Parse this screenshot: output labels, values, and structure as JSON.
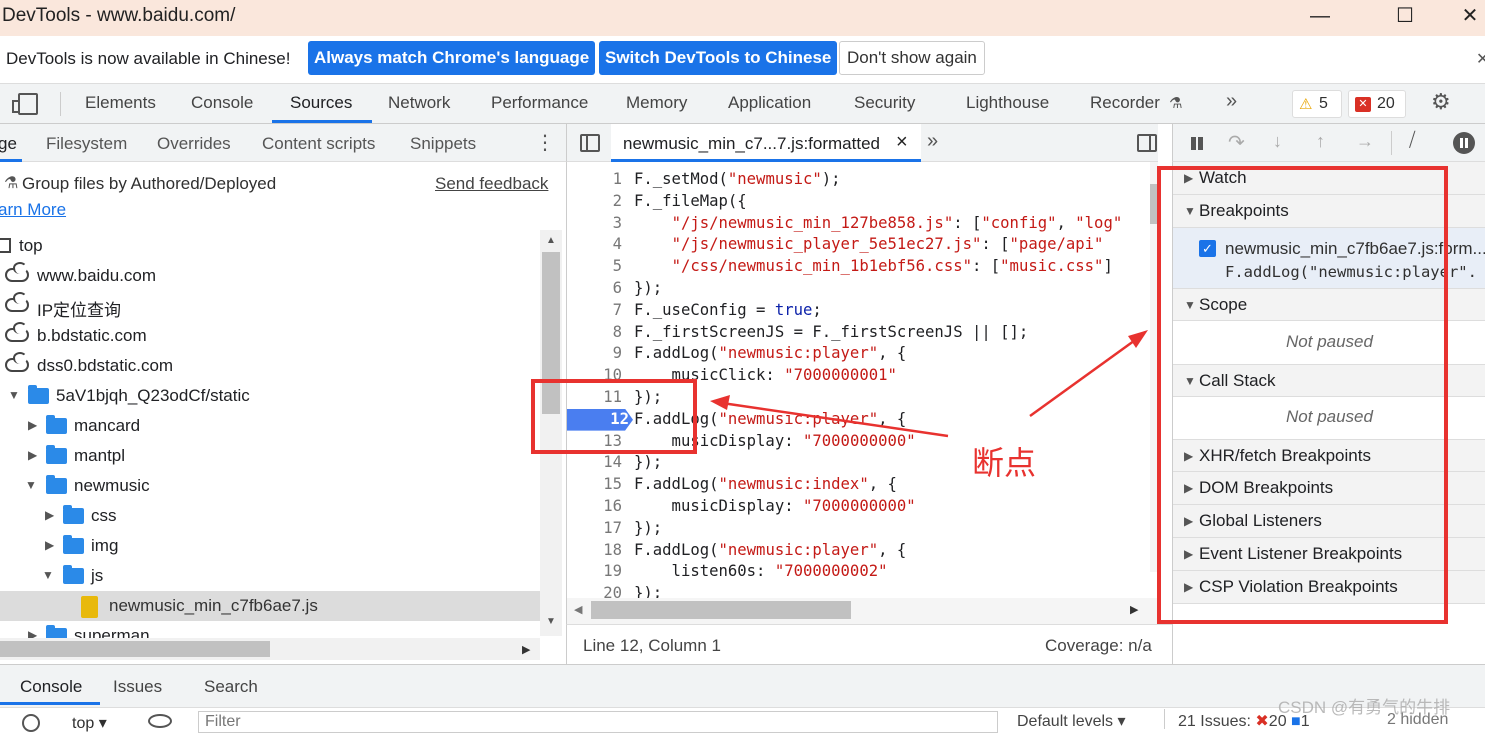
{
  "window": {
    "title": "DevTools - www.baidu.com/",
    "minimize": "—",
    "maximize": "☐",
    "close": "✕"
  },
  "infobar": {
    "message": "DevTools is now available in Chinese!",
    "btn_match": "Always match Chrome's language",
    "btn_switch": "Switch DevTools to Chinese",
    "btn_dont": "Don't show again",
    "close": "✕"
  },
  "maintabs": {
    "items": [
      "Elements",
      "Console",
      "Sources",
      "Network",
      "Performance",
      "Memory",
      "Application",
      "Security",
      "Lighthouse",
      "Recorder"
    ],
    "more": "»",
    "warnings": "5",
    "errors": "20"
  },
  "navigator": {
    "tabs": [
      "ge",
      "Filesystem",
      "Overrides",
      "Content scripts",
      "Snippets"
    ],
    "group_files": "Group files by Authored/Deployed",
    "send_feedback": "Send feedback",
    "learn_more": "arn More",
    "tree": [
      "top",
      "www.baidu.com",
      "IP定位查询",
      "b.bdstatic.com",
      "dss0.bdstatic.com",
      "5aV1bjqh_Q23odCf/static",
      "mancard",
      "mantpl",
      "newmusic",
      "css",
      "img",
      "js",
      "newmusic_min_c7fb6ae7.js",
      "superman"
    ]
  },
  "editor": {
    "tab_name": "newmusic_min_c7...7.js:formatted",
    "tab_close": "×",
    "more": "»",
    "lines": [
      {
        "n": "1",
        "parts": [
          [
            "F._setMod(",
            ""
          ],
          [
            "\"newmusic\"",
            "str"
          ],
          [
            ");",
            ""
          ]
        ]
      },
      {
        "n": "2",
        "parts": [
          [
            "F._fileMap({",
            ""
          ]
        ]
      },
      {
        "n": "3",
        "parts": [
          [
            "    ",
            ""
          ],
          [
            "\"/js/newmusic_min_127be858.js\"",
            "str"
          ],
          [
            ": [",
            ""
          ],
          [
            "\"config\"",
            "str"
          ],
          [
            ", ",
            ""
          ],
          [
            "\"log\"",
            "str"
          ]
        ]
      },
      {
        "n": "4",
        "parts": [
          [
            "    ",
            ""
          ],
          [
            "\"/js/newmusic_player_5e51ec27.js\"",
            "str"
          ],
          [
            ": [",
            ""
          ],
          [
            "\"page/api\"",
            "str"
          ]
        ]
      },
      {
        "n": "5",
        "parts": [
          [
            "    ",
            ""
          ],
          [
            "\"/css/newmusic_min_1b1ebf56.css\"",
            "str"
          ],
          [
            ": [",
            ""
          ],
          [
            "\"music.css\"",
            "str"
          ],
          [
            "]",
            ""
          ]
        ]
      },
      {
        "n": "6",
        "parts": [
          [
            "});",
            ""
          ]
        ]
      },
      {
        "n": "7",
        "parts": [
          [
            "F._useConfig = ",
            ""
          ],
          [
            "true",
            "kw"
          ],
          [
            ";",
            ""
          ]
        ]
      },
      {
        "n": "8",
        "parts": [
          [
            "F._firstScreenJS = F._firstScreenJS || [];",
            ""
          ]
        ]
      },
      {
        "n": "9",
        "parts": [
          [
            "F.addLog(",
            ""
          ],
          [
            "\"newmusic:player\"",
            "str"
          ],
          [
            ", {",
            ""
          ]
        ]
      },
      {
        "n": "10",
        "parts": [
          [
            "    musicClick: ",
            ""
          ],
          [
            "\"7000000001\"",
            "str"
          ]
        ]
      },
      {
        "n": "11",
        "parts": [
          [
            "});",
            ""
          ]
        ]
      },
      {
        "n": "12",
        "parts": [
          [
            "F.addLog(",
            ""
          ],
          [
            "\"newmusic:player\"",
            "str"
          ],
          [
            ", {",
            ""
          ]
        ]
      },
      {
        "n": "13",
        "parts": [
          [
            "    musicDisplay: ",
            ""
          ],
          [
            "\"7000000000\"",
            "str"
          ]
        ]
      },
      {
        "n": "14",
        "parts": [
          [
            "});",
            ""
          ]
        ]
      },
      {
        "n": "15",
        "parts": [
          [
            "F.addLog(",
            ""
          ],
          [
            "\"newmusic:index\"",
            "str"
          ],
          [
            ", {",
            ""
          ]
        ]
      },
      {
        "n": "16",
        "parts": [
          [
            "    musicDisplay: ",
            ""
          ],
          [
            "\"7000000000\"",
            "str"
          ]
        ]
      },
      {
        "n": "17",
        "parts": [
          [
            "});",
            ""
          ]
        ]
      },
      {
        "n": "18",
        "parts": [
          [
            "F.addLog(",
            ""
          ],
          [
            "\"newmusic:player\"",
            "str"
          ],
          [
            ", {",
            ""
          ]
        ]
      },
      {
        "n": "19",
        "parts": [
          [
            "    listen60s: ",
            ""
          ],
          [
            "\"7000000002\"",
            "str"
          ]
        ]
      },
      {
        "n": "20",
        "parts": [
          [
            "});",
            ""
          ]
        ]
      }
    ],
    "status_left": "Line 12, Column 1",
    "status_right": "Coverage: n/a"
  },
  "debugger": {
    "sections": {
      "watch": "Watch",
      "breakpoints": "Breakpoints",
      "scope": "Scope",
      "call_stack": "Call Stack",
      "xhr": "XHR/fetch Breakpoints",
      "dom": "DOM Breakpoints",
      "global": "Global Listeners",
      "event": "Event Listener Breakpoints",
      "csp": "CSP Violation Breakpoints"
    },
    "breakpoint_file": "newmusic_min_c7fb6ae7.js:form...",
    "breakpoint_code": "F.addLog(\"newmusic:player\".",
    "not_paused": "Not paused"
  },
  "annotation": {
    "label": "断点"
  },
  "drawer": {
    "tabs": [
      "Console",
      "Issues",
      "Search"
    ],
    "context": "top",
    "filter_placeholder": "Filter",
    "levels": "Default levels",
    "issues": "21 Issues:",
    "issues_err": "20",
    "issues_info": "1",
    "hidden": "2 hidden"
  },
  "watermark": "CSDN @有勇气的牛排",
  "colors": {
    "accent": "#1a73e8",
    "annotation_red": "#e8322f",
    "titlebar": "#fae7dc"
  }
}
